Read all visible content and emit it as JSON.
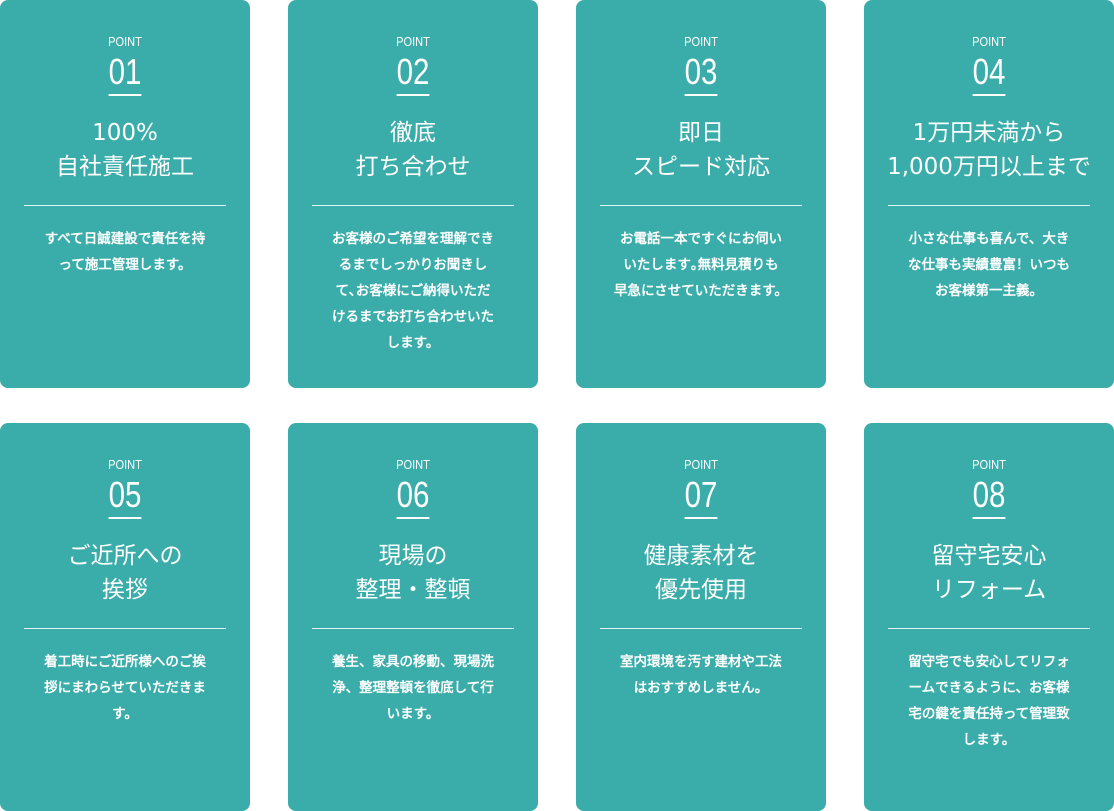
{
  "colors": {
    "card_background": "#3aaca9",
    "text": "#ffffff",
    "page_background": "#ffffff"
  },
  "point_label": "POINT",
  "cards": [
    {
      "number": "01",
      "title": "100%\n自社責任施工",
      "description": "すべて日誠建設で責任を持\nって施工管理します。"
    },
    {
      "number": "02",
      "title": "徹底\n打ち合わせ",
      "description": "お客様のご希望を理解でき\nるまでしっかりお聞きし\nて､お客様にご納得いただ\nけるまでお打ち合わせいた\nします。"
    },
    {
      "number": "03",
      "title": "即日\nスピード対応",
      "description": "お電話一本ですぐにお伺い\nいたします｡無料見積りも\n早急にさせていただきます。"
    },
    {
      "number": "04",
      "title": "1万円未満から\n1,000万円以上まで",
      "description": "小さな仕事も喜んで、大き\nな仕事も実績豊富！いつも\nお客様第一主義。"
    },
    {
      "number": "05",
      "title": "ご近所への\n挨拶",
      "description": "着工時にご近所様へのご挨\n拶にまわらせていただきま\nす。"
    },
    {
      "number": "06",
      "title": "現場の\n整理・整頓",
      "description": "養生、家具の移動、現場洗\n浄、整理整頓を徹底して行\nいます。"
    },
    {
      "number": "07",
      "title": "健康素材を\n優先使用",
      "description": "室内環境を汚す建材や工法\nはおすすめしません。"
    },
    {
      "number": "08",
      "title": "留守宅安心\nリフォーム",
      "description": "留守宅でも安心してリフォ\nームできるように、お客様\n宅の鍵を責任持って管理致\nします。"
    }
  ]
}
